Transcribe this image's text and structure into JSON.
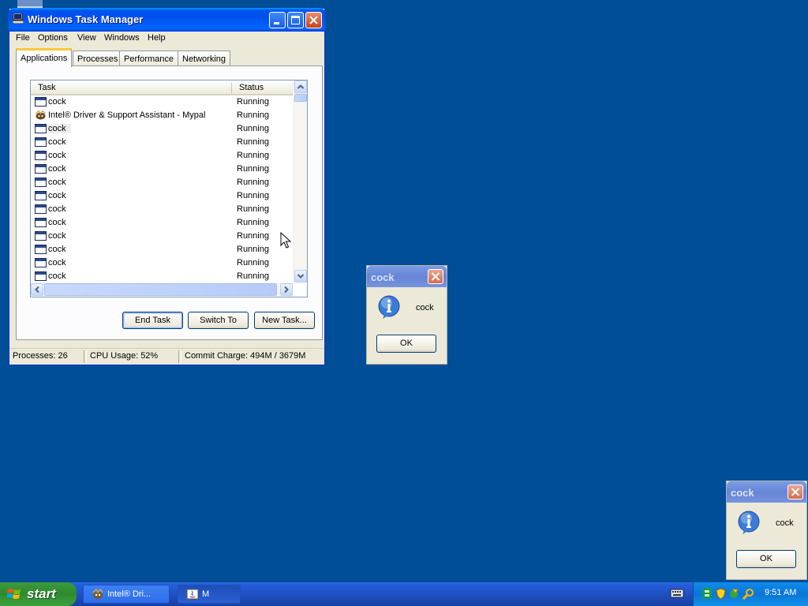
{
  "colors": {
    "desktop": "#004e98",
    "titlebar": "#0053ee",
    "inactive_titlebar": "#7693de",
    "start": "#3c9a3c"
  },
  "task_manager": {
    "title": "Windows Task Manager",
    "menu": [
      "File",
      "Options",
      "View",
      "Windows",
      "Help"
    ],
    "tabs": [
      "Applications",
      "Processes",
      "Performance",
      "Networking"
    ],
    "active_tab": "Applications",
    "columns": {
      "task": "Task",
      "status": "Status"
    },
    "rows": [
      {
        "task": "cock",
        "status": "Running",
        "icon": "window-icon"
      },
      {
        "task": "Intel® Driver & Support Assistant - Mypal",
        "status": "Running",
        "icon": "mypal-icon"
      },
      {
        "task": "cock",
        "status": "Running",
        "icon": "window-icon"
      },
      {
        "task": "cock",
        "status": "Running",
        "icon": "window-icon"
      },
      {
        "task": "cock",
        "status": "Running",
        "icon": "window-icon"
      },
      {
        "task": "cock",
        "status": "Running",
        "icon": "window-icon"
      },
      {
        "task": "cock",
        "status": "Running",
        "icon": "window-icon"
      },
      {
        "task": "cock",
        "status": "Running",
        "icon": "window-icon"
      },
      {
        "task": "cock",
        "status": "Running",
        "icon": "window-icon"
      },
      {
        "task": "cock",
        "status": "Running",
        "icon": "window-icon"
      },
      {
        "task": "cock",
        "status": "Running",
        "icon": "window-icon"
      },
      {
        "task": "cock",
        "status": "Running",
        "icon": "window-icon"
      },
      {
        "task": "cock",
        "status": "Running",
        "icon": "window-icon"
      },
      {
        "task": "cock",
        "status": "Running",
        "icon": "window-icon"
      }
    ],
    "buttons": {
      "end_task": "End Task",
      "switch_to": "Switch To",
      "new_task": "New Task..."
    },
    "statusbar": {
      "processes": "Processes: 26",
      "cpu": "CPU Usage: 52%",
      "commit": "Commit Charge: 494M / 3679M"
    }
  },
  "dialogs": [
    {
      "title": "cock",
      "message": "cock",
      "ok": "OK"
    },
    {
      "title": "cock",
      "message": "cock",
      "ok": "OK"
    }
  ],
  "taskbar": {
    "start": "start",
    "items": [
      {
        "label": "Intel® Dri..."
      },
      {
        "label": "M"
      }
    ],
    "clock": "9:51 AM"
  }
}
